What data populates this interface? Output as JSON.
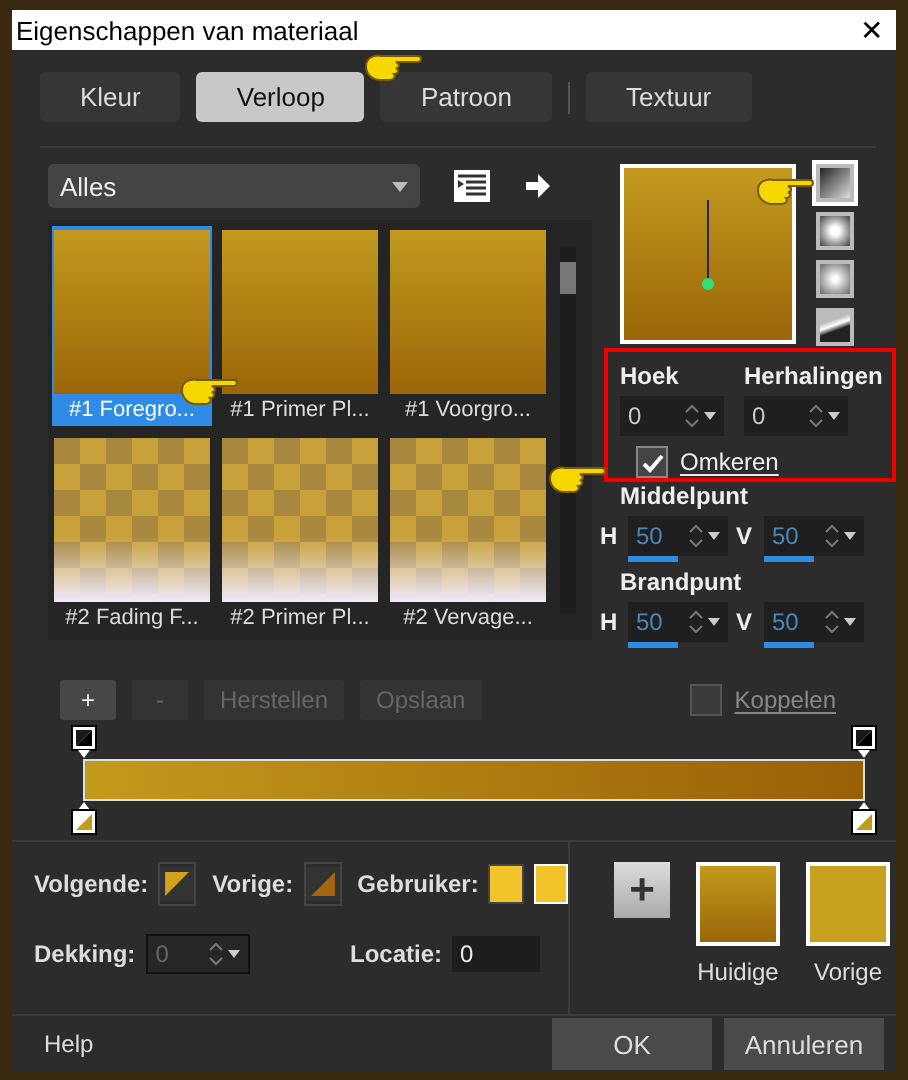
{
  "window": {
    "title": "Eigenschappen van materiaal",
    "close": "✕"
  },
  "tabs": [
    {
      "label": "Kleur",
      "selected": false
    },
    {
      "label": "Verloop",
      "selected": true
    },
    {
      "label": "Patroon",
      "selected": false
    },
    {
      "label": "Textuur",
      "selected": false
    }
  ],
  "category": {
    "value": "Alles"
  },
  "gradients": [
    {
      "label": "#1 Foregro...",
      "kind": "opaque",
      "selected": true
    },
    {
      "label": "#1 Primer Pl...",
      "kind": "opaque",
      "selected": false
    },
    {
      "label": "#1 Voorgro...",
      "kind": "opaque",
      "selected": false
    },
    {
      "label": "#2 Fading F...",
      "kind": "fading",
      "selected": false
    },
    {
      "label": "#2 Primer Pl...",
      "kind": "fading",
      "selected": false
    },
    {
      "label": "#2 Vervage...",
      "kind": "fading",
      "selected": false
    }
  ],
  "styles": [
    {
      "kind": "linear",
      "selected": true
    },
    {
      "kind": "rect",
      "selected": false
    },
    {
      "kind": "radial",
      "selected": false
    },
    {
      "kind": "sunburst",
      "selected": false
    }
  ],
  "hoek": {
    "label": "Hoek",
    "value": "0"
  },
  "herhalingen": {
    "label": "Herhalingen",
    "value": "0"
  },
  "omkeren": {
    "label": "Omkeren",
    "checked": true
  },
  "koppelen": {
    "label": "Koppelen",
    "checked": false,
    "disabled": true
  },
  "middelpunt": {
    "label": "Middelpunt",
    "fields": [
      {
        "axis": "H",
        "value": "50",
        "level": 0.5,
        "disabled": true
      },
      {
        "axis": "V",
        "value": "50",
        "level": 0.5,
        "disabled": true
      }
    ]
  },
  "brandpunt": {
    "label": "Brandpunt",
    "fields": [
      {
        "axis": "H",
        "value": "50",
        "level": 0.5,
        "disabled": true
      },
      {
        "axis": "V",
        "value": "50",
        "level": 0.5,
        "disabled": true
      }
    ]
  },
  "stop_buttons": [
    {
      "label": "+",
      "disabled": false
    },
    {
      "label": "-",
      "disabled": true
    },
    {
      "label": "Herstellen",
      "disabled": true
    },
    {
      "label": "Opslaan",
      "disabled": true
    }
  ],
  "volgende": "Volgende:",
  "vorige": "Vorige:",
  "gebruiker": "Gebruiker:",
  "dekking": {
    "label": "Dekking:",
    "value": "0",
    "disabled": true
  },
  "locatie": {
    "label": "Locatie:",
    "value": "0"
  },
  "add": "+",
  "swatches": [
    {
      "label": "Huidige",
      "kind": "gradient"
    },
    {
      "label": "Vorige",
      "kind": "solid"
    }
  ],
  "footer": {
    "help": "Help",
    "ok": "OK",
    "cancel": "Annuleren"
  }
}
